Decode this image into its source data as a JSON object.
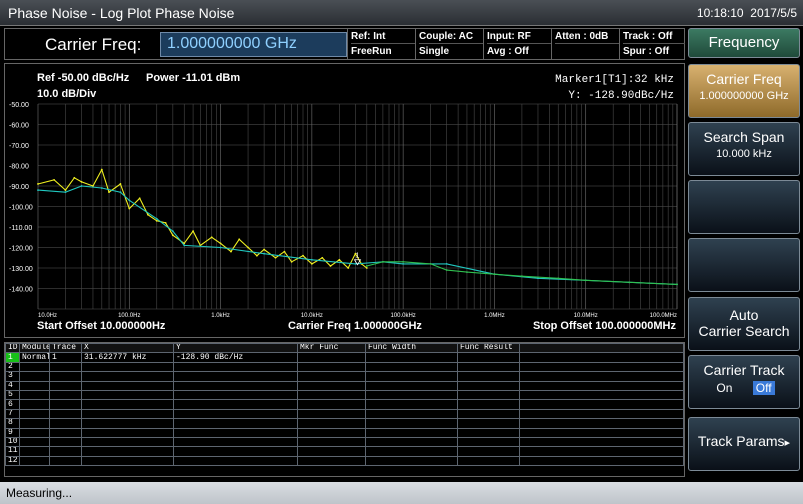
{
  "window": {
    "title": "Phase Noise - Log Plot Phase Noise",
    "time": "10:18:10",
    "date": "2017/5/5"
  },
  "infobar": {
    "carrier_label": "Carrier Freq:",
    "carrier_value": "1.000000000 GHz",
    "cells": [
      {
        "top": "Ref: Int",
        "bottom": "FreeRun"
      },
      {
        "top": "Couple: AC",
        "bottom": "Single"
      },
      {
        "top": "Input: RF",
        "bottom": "Avg : Off"
      },
      {
        "top": "Atten : 0dB",
        "bottom": ""
      },
      {
        "top": "Track : Off",
        "bottom": "Spur : Off"
      }
    ]
  },
  "plot": {
    "ref_text": "Ref -50.00 dBc/Hz",
    "power_text": "Power -11.01 dBm",
    "scale_text": "10.0 dB/Div",
    "marker_line1": "Marker1[T1]:32 kHz",
    "marker_line2": "Y: -128.90dBc/Hz",
    "marker_label": "1",
    "start_offset": "Start Offset 10.000000Hz",
    "center_text": "Carrier Freq 1.000000GHz",
    "stop_offset": "Stop Offset 100.000000MHz"
  },
  "chart_data": {
    "type": "line",
    "xscale": "log",
    "xlim": [
      10,
      100000000
    ],
    "ylim": [
      -150,
      -50
    ],
    "ylabel_ticks": [
      "-50.00",
      "-60.00",
      "-70.00",
      "-80.00",
      "-90.00",
      "-100.00",
      "-110.00",
      "-120.00",
      "-130.00",
      "-140.00"
    ],
    "xtick_labels": [
      "10.0Hz",
      "100.0Hz",
      "1.0kHz",
      "10.0kHz",
      "100.0kHz",
      "1.0MHz",
      "10.0MHz",
      "100.0MHz"
    ],
    "grid": true,
    "series": [
      {
        "color": "#f0f020",
        "x": [
          10,
          15,
          20,
          25,
          30,
          40,
          50,
          60,
          80,
          100,
          130,
          160,
          200,
          250,
          300,
          400,
          500,
          600,
          800,
          1000,
          1300,
          1600,
          2000,
          2500,
          3000,
          4000,
          5000,
          6000,
          8000,
          10000,
          13000,
          16000,
          20000,
          25000,
          30000,
          35000,
          40000
        ],
        "y": [
          -89,
          -87,
          -92,
          -86,
          -88,
          -90,
          -82,
          -93,
          -89,
          -101,
          -96,
          -104,
          -107,
          -108,
          -114,
          -118,
          -112,
          -119,
          -115,
          -118,
          -122,
          -116,
          -120,
          -124,
          -121,
          -125,
          -122,
          -127,
          -124,
          -128,
          -125,
          -129,
          -126,
          -130,
          -123,
          -128,
          -130
        ]
      },
      {
        "color": "#20c8c0",
        "x": [
          10,
          20,
          30,
          50,
          80,
          100,
          200,
          300,
          400,
          1000,
          3000,
          10000,
          30000,
          60000,
          100000,
          300000,
          1000000,
          3000000,
          10000000,
          30000000,
          100000000
        ],
        "y": [
          -92,
          -93,
          -90,
          -91,
          -93,
          -97,
          -106,
          -112,
          -119,
          -120,
          -123,
          -126,
          -128,
          -127,
          -128,
          -128,
          -133,
          -135,
          -136,
          -137,
          -138
        ]
      },
      {
        "color": "#30c050",
        "x": [
          40000,
          60000,
          100000,
          200000,
          300000,
          500000,
          1000000,
          2000000,
          5000000,
          10000000,
          30000000,
          100000000
        ],
        "y": [
          -129,
          -127,
          -127,
          -128,
          -131,
          -132,
          -133,
          -134,
          -135,
          -136,
          -137,
          -138
        ]
      }
    ],
    "marker": {
      "x": 31622.777,
      "y": -128.9
    }
  },
  "table": {
    "headers": [
      "ID",
      "Module",
      "Trace",
      "X",
      "Y",
      "Mkr Func",
      "Func Width",
      "Func Result",
      ""
    ],
    "rows": [
      [
        "1",
        "Normal",
        "1",
        "31.622777 kHz",
        "-128.90 dBc/Hz",
        "",
        "",
        "",
        ""
      ],
      [
        "2",
        "",
        "",
        "",
        "",
        "",
        "",
        "",
        ""
      ],
      [
        "3",
        "",
        "",
        "",
        "",
        "",
        "",
        "",
        ""
      ],
      [
        "4",
        "",
        "",
        "",
        "",
        "",
        "",
        "",
        ""
      ],
      [
        "5",
        "",
        "",
        "",
        "",
        "",
        "",
        "",
        ""
      ],
      [
        "6",
        "",
        "",
        "",
        "",
        "",
        "",
        "",
        ""
      ],
      [
        "7",
        "",
        "",
        "",
        "",
        "",
        "",
        "",
        ""
      ],
      [
        "8",
        "",
        "",
        "",
        "",
        "",
        "",
        "",
        ""
      ],
      [
        "9",
        "",
        "",
        "",
        "",
        "",
        "",
        "",
        ""
      ],
      [
        "10",
        "",
        "",
        "",
        "",
        "",
        "",
        "",
        ""
      ],
      [
        "11",
        "",
        "",
        "",
        "",
        "",
        "",
        "",
        ""
      ],
      [
        "12",
        "",
        "",
        "",
        "",
        "",
        "",
        "",
        ""
      ]
    ]
  },
  "softkeys": {
    "header": "Frequency",
    "carrier_freq_label": "Carrier Freq",
    "carrier_freq_value": "1.000000000 GHz",
    "search_span_label": "Search Span",
    "search_span_value": "10.000 kHz",
    "auto_search_line1": "Auto",
    "auto_search_line2": "Carrier Search",
    "carrier_track_label": "Carrier Track",
    "carrier_track_on": "On",
    "carrier_track_off": "Off",
    "track_params_label": "Track Params",
    "track_params_arrow": "▸"
  },
  "status": {
    "text": "Measuring..."
  }
}
